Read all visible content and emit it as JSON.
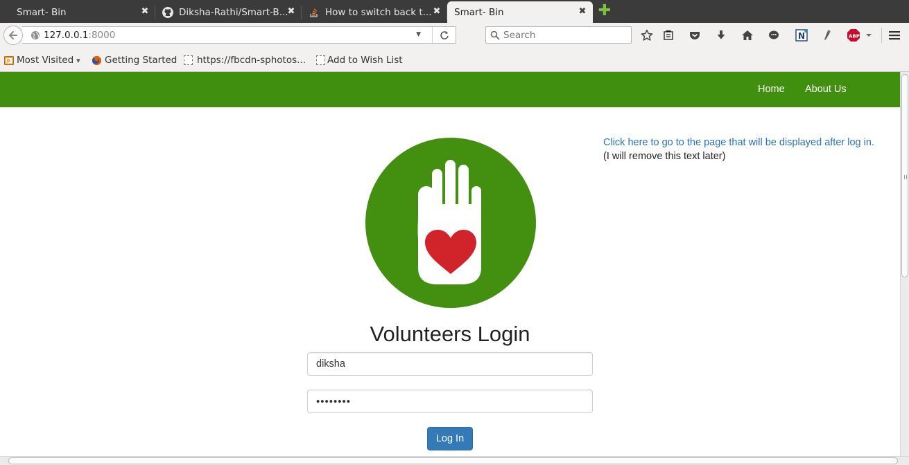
{
  "browser": {
    "tabs": [
      {
        "title": "Smart- Bin",
        "icon": "none",
        "active": false
      },
      {
        "title": "Diksha-Rathi/Smart-B...",
        "icon": "github-icon",
        "active": false
      },
      {
        "title": "How to switch back t...",
        "icon": "stackoverflow-icon",
        "active": false
      },
      {
        "title": "Smart- Bin",
        "icon": "none",
        "active": true
      }
    ],
    "close_glyph": "✖",
    "new_tab_glyph": "✚",
    "url_host": "127.0.0.1",
    "url_port": ":8000",
    "search_placeholder": "Search",
    "bookmarks": [
      {
        "label": "Most Visited",
        "icon": "rss-folder-icon",
        "dropdown": "▾"
      },
      {
        "label": "Getting Started",
        "icon": "firefox-icon"
      },
      {
        "label": "https://fbcdn-sphotos...",
        "icon": "blank-page-icon"
      },
      {
        "label": "Add to Wish List",
        "icon": "blank-page-icon"
      }
    ]
  },
  "site": {
    "nav": {
      "home": "Home",
      "about": "About Us"
    },
    "note_link": "Click here to go to the page that will be displayed after log in.",
    "note_text": "(I will remove this text later)",
    "login": {
      "title": "Volunteers Login",
      "username_value": "diksha",
      "password_value": "••••••••",
      "button": "Log In"
    },
    "colors": {
      "nav_bg": "#418f0f",
      "logo_circle": "#438f10",
      "heart": "#d0242a",
      "button": "#337ab7",
      "link": "#2a72b5"
    }
  }
}
